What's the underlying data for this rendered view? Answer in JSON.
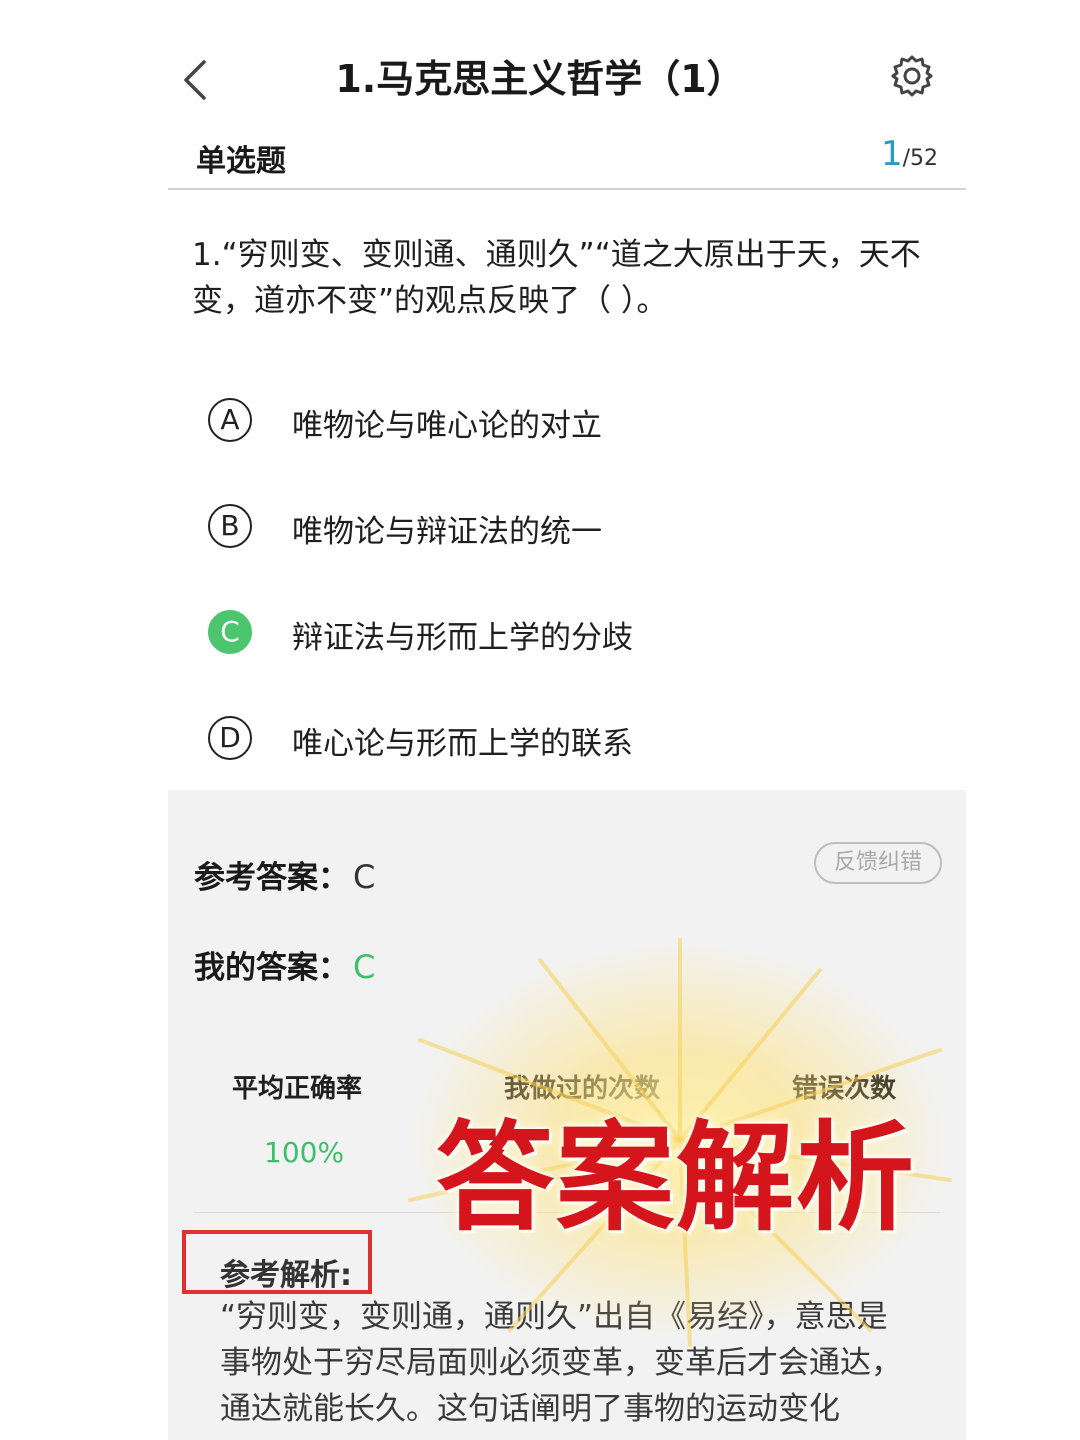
{
  "header": {
    "title": "1.马克思主义哲学（1）",
    "back_icon": "chevron-left-icon",
    "settings_icon": "gear-icon"
  },
  "section": {
    "label": "单选题",
    "current": "1",
    "total": "/52"
  },
  "question": {
    "text": "1.“穷则变、变则通、通则久”“道之大原出于天，天不变，道亦不变”的观点反映了（ ）。"
  },
  "options": [
    {
      "letter": "A",
      "text": "唯物论与唯心论的对立",
      "state": "normal"
    },
    {
      "letter": "B",
      "text": "唯物论与辩证法的统一",
      "state": "normal"
    },
    {
      "letter": "C",
      "text": "辩证法与形而上学的分歧",
      "state": "correct"
    },
    {
      "letter": "D",
      "text": "唯心论与形而上学的联系",
      "state": "normal"
    }
  ],
  "answer_panel": {
    "reference_label": "参考答案：",
    "reference_value": "C",
    "mine_label": "我的答案：",
    "mine_value": "C",
    "feedback_button": "反馈纠错"
  },
  "stats": {
    "accuracy_label": "平均正确率",
    "accuracy_value": "100%",
    "times_label": "我做过的次数",
    "errors_label": "错误次数"
  },
  "analysis": {
    "label": "参考解析:",
    "text": "“穷则变，变则通，通则久”出自《易经》，意思是事物处于穷尽局面则必须变革，变革后才会通达，通达就能长久。这句话阐明了事物的运动变化"
  },
  "overlay": {
    "title": "答案解析"
  },
  "colors": {
    "correct_green": "#4cc56f",
    "counter_blue": "#2a9cbf",
    "highlight_red": "#e03030",
    "overlay_red": "#d4161c"
  }
}
